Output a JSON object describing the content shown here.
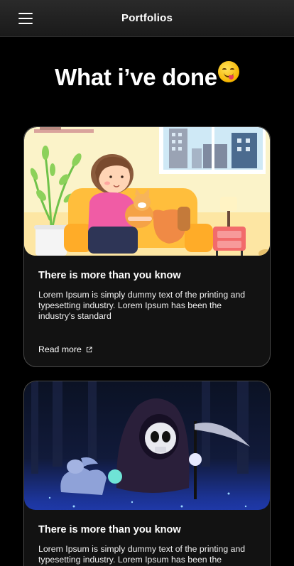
{
  "header": {
    "title": "Portfolios",
    "menu_icon": "hamburger-menu-icon"
  },
  "main": {
    "headline": "What i’ve done",
    "headline_emoji": "face-savoring-food-emoji"
  },
  "cards": [
    {
      "title": "There is more than you know",
      "text": "Lorem Ipsum is simply dummy text of the printing and typesetting industry. Lorem Ipsum has been the industry's standard",
      "link": "Read more",
      "link_icon": "external-link-icon",
      "image": "girl-with-cat-illustration"
    },
    {
      "title": "There is more than you know",
      "text": "Lorem Ipsum is simply dummy text of the printing and typesetting industry. Lorem Ipsum has been the",
      "image": "grim-reaper-illustration"
    }
  ],
  "colors": {
    "background": "#000000",
    "card_border": "#4a4a4a",
    "header_bg": "#222222"
  }
}
